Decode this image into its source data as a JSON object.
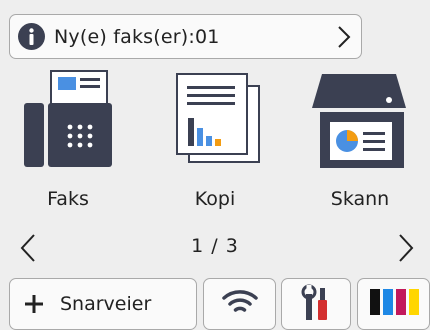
{
  "notification": {
    "icon": "info-icon",
    "text": "Ny(e) faks(er):01",
    "arrow_icon": "chevron-right-icon"
  },
  "apps": [
    {
      "label": "Faks",
      "icon": "fax-icon"
    },
    {
      "label": "Kopi",
      "icon": "copy-icon"
    },
    {
      "label": "Skann",
      "icon": "scan-icon"
    }
  ],
  "pager": {
    "indicator": "1 / 3",
    "current_page": 1,
    "total_pages": 3,
    "prev_icon": "chevron-left-icon",
    "next_icon": "chevron-right-icon"
  },
  "dock": {
    "shortcuts_label": "Snarveier",
    "shortcuts_icon": "plus-icon",
    "wifi_icon": "wifi-icon",
    "tools_icon": "tools-icon",
    "ink_icon": "ink-icon"
  },
  "colors": {
    "background": "#eeeeee",
    "icon_dark": "#3b4052",
    "accent_blue": "#4a90e2",
    "accent_orange": "#f39c12",
    "ink_black": "#111111",
    "ink_cyan": "#1e88e5",
    "ink_magenta": "#c2185b",
    "ink_yellow": "#ffd600",
    "tools_red": "#d32f2f"
  }
}
